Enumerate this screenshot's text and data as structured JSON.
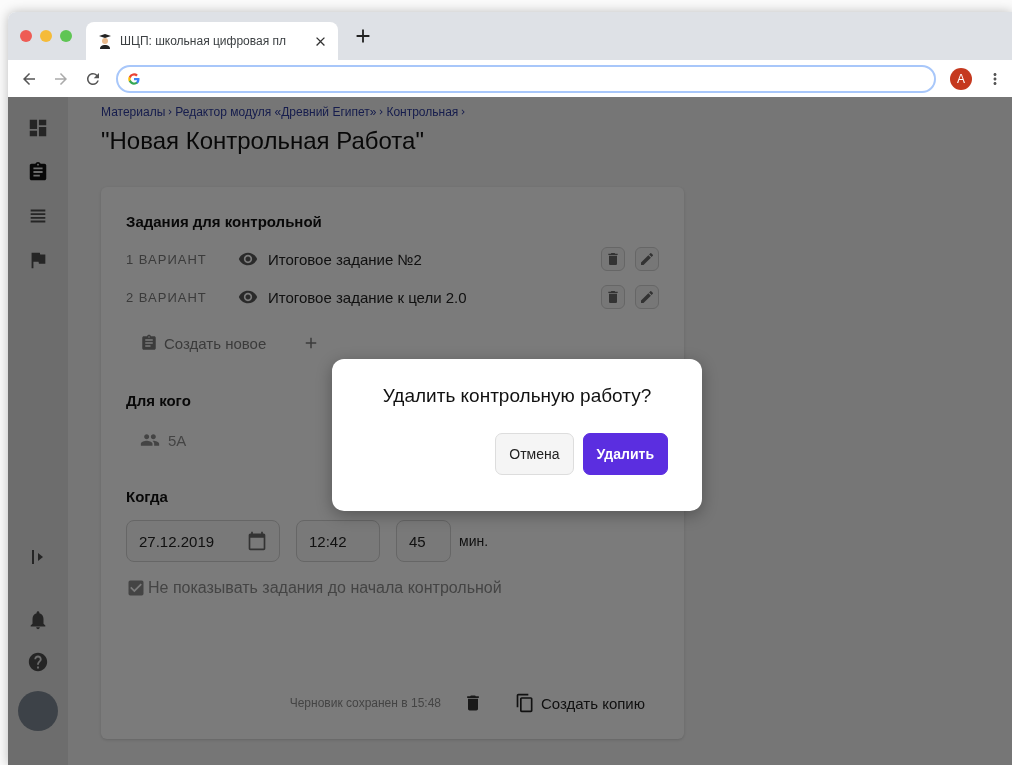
{
  "browser": {
    "tab_title": "ШЦП: школьная цифровая пл",
    "profile_letter": "А"
  },
  "sidebar": {
    "items": [
      {
        "kind": "dashboard",
        "selected": false
      },
      {
        "kind": "assignment",
        "selected": true
      },
      {
        "kind": "list",
        "selected": false
      },
      {
        "kind": "flag",
        "selected": false
      }
    ]
  },
  "breadcrumbs": [
    "Материалы",
    "Редактор модуля «Древний Египет»",
    "Контрольная"
  ],
  "title": "\"Новая Контрольная Работа\"",
  "tasks": {
    "heading": "Задания для контрольной",
    "variants": [
      {
        "label": "1 ВАРИАНТ",
        "name": "Итоговое задание №2"
      },
      {
        "label": "2 ВАРИАНТ",
        "name": "Итоговое задание к цели 2.0"
      }
    ],
    "create_new": "Создать новое"
  },
  "audience": {
    "heading": "Для кого",
    "group": "5А"
  },
  "when": {
    "heading": "Когда",
    "date": "27.12.2019",
    "time": "12:42",
    "duration": "45",
    "unit": "мин.",
    "hide_tasks": {
      "label": "Не показывать задания до начала контрольной",
      "checked": true
    }
  },
  "footer": {
    "draft_status": "Черновик сохранен в 15:48",
    "copy": "Создать копию"
  },
  "dialog": {
    "title": "Удалить контрольную работу?",
    "cancel": "Отмена",
    "confirm": "Удалить"
  }
}
